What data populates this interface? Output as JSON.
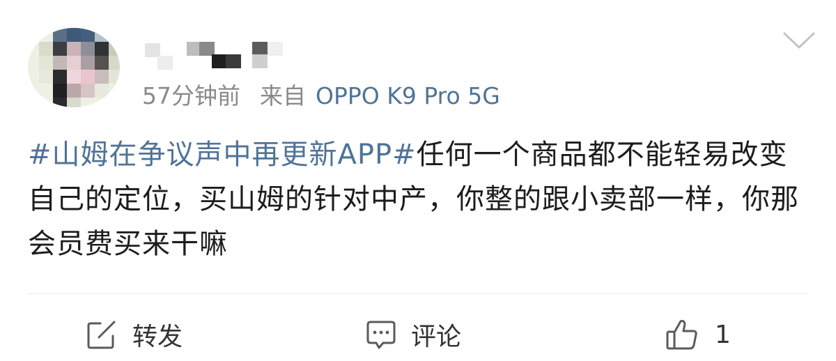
{
  "post": {
    "timestamp": "57分钟前",
    "source_prefix": "来自",
    "device": "OPPO K9 Pro 5G",
    "hashtag": "#山姆在争议声中再更新APP#",
    "body": "任何一个商品都不能轻易改变自己的定位，买山姆的针对中产，你整的跟小卖部一样，你那会员费买来干嘛"
  },
  "actions": {
    "repost_label": "转发",
    "comment_label": "评论",
    "like_count": "1"
  },
  "colors": {
    "link": "#4f7397",
    "meta": "#8a8a8a",
    "text": "#1c1c1c",
    "icon": "#5a5a5a"
  },
  "icons": [
    "chevron-down-icon",
    "repost-icon",
    "comment-icon",
    "thumbs-up-icon"
  ]
}
